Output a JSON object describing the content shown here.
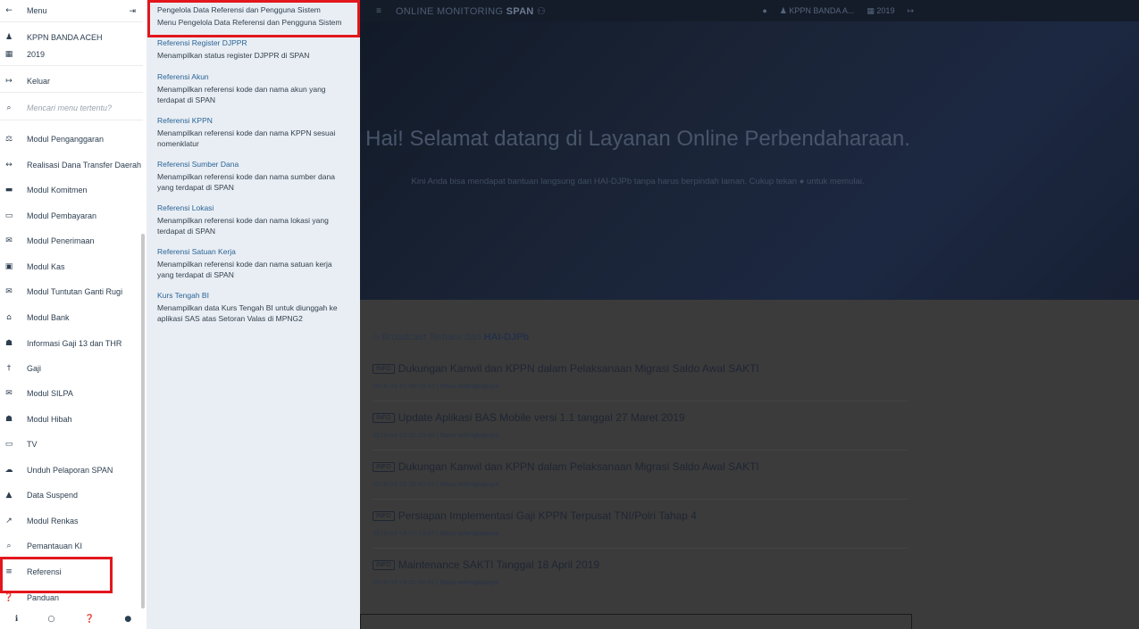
{
  "sidebar": {
    "menu_label": "Menu",
    "user": "KPPN BANDA ACEH",
    "year": "2019",
    "logout": "Keluar",
    "search_placeholder": "Mencari menu tertentu?",
    "items": [
      {
        "label": "Modul Penganggaran",
        "icon": "balance-scale-icon"
      },
      {
        "label": "Realisasi Dana Transfer Daerah",
        "icon": "arrows-h-icon"
      },
      {
        "label": "Modul Komitmen",
        "icon": "archive-icon"
      },
      {
        "label": "Modul Pembayaran",
        "icon": "credit-card-icon"
      },
      {
        "label": "Modul Penerimaan",
        "icon": "envelope-icon"
      },
      {
        "label": "Modul Kas",
        "icon": "money-icon"
      },
      {
        "label": "Modul Tuntutan Ganti Rugi",
        "icon": "envelope-icon"
      },
      {
        "label": "Modul Bank",
        "icon": "bank-icon"
      },
      {
        "label": "Informasi Gaji 13 dan THR",
        "icon": "gift-icon"
      },
      {
        "label": "Gaji",
        "icon": "male-icon"
      },
      {
        "label": "Modul SILPA",
        "icon": "envelope-icon"
      },
      {
        "label": "Modul Hibah",
        "icon": "gift-icon"
      },
      {
        "label": "TV",
        "icon": "desktop-icon"
      },
      {
        "label": "Unduh Pelaporan SPAN",
        "icon": "cloud-download-icon"
      },
      {
        "label": "Data Suspend",
        "icon": "warning-icon"
      },
      {
        "label": "Modul Renkas",
        "icon": "line-chart-icon"
      },
      {
        "label": "Pemantauan KI",
        "icon": "search-icon"
      },
      {
        "label": "Referensi",
        "icon": "signpost-icon"
      },
      {
        "label": "Panduan",
        "icon": "question-circle-icon"
      }
    ]
  },
  "submenu": {
    "items": [
      {
        "title": "Pengelola Data Referensi dan Pengguna Sistem",
        "desc": "Menu Pengelola Data Referensi dan Pengguna Sistem"
      },
      {
        "title": "Referensi Register DJPPR",
        "desc": "Menampilkan status register DJPPR di SPAN"
      },
      {
        "title": "Referensi Akun",
        "desc": "Menampilkan referensi kode dan nama akun yang terdapat di SPAN"
      },
      {
        "title": "Referensi KPPN",
        "desc": "Menampilkan referensi kode dan nama KPPN sesuai nomenklatur"
      },
      {
        "title": "Referensi Sumber Dana",
        "desc": "Menampilkan referensi kode dan nama sumber dana yang terdapat di SPAN"
      },
      {
        "title": "Referensi Lokasi",
        "desc": "Menampilkan referensi kode dan nama lokasi yang terdapat di SPAN"
      },
      {
        "title": "Referensi Satuan Kerja",
        "desc": "Menampilkan referensi kode dan nama satuan kerja yang terdapat di SPAN"
      },
      {
        "title": "Kurs Tengah BI",
        "desc": "Menampilkan data Kurs Tengah BI untuk diunggah ke aplikasi SAS atas Setoran Valas di MPNG2"
      }
    ]
  },
  "topbar": {
    "brand_prefix": "ONLINE MONITORING ",
    "brand_bold": "SPAN",
    "user": "KPPN BANDA A...",
    "year": "2019"
  },
  "hero": {
    "title": "Hai! Selamat datang di Layanan Online Perbendaharaan.",
    "subtitle_a": "Kini Anda bisa mendapat bantuan langsung dari HAI-DJPb tanpa harus berpindah laman. Cukup tekan",
    "subtitle_b": "untuk memulai."
  },
  "broadcast": {
    "heading_prefix": "Broadcast Terbaru dari ",
    "heading_bold": "HAI-DJPb",
    "read_more": "Baca selengkapnya",
    "badge": "INFO",
    "news": [
      {
        "title": "Dukungan Kanwil dan KPPN dalam Pelaksanaan Migrasi Saldo Awal SAKTI",
        "date": "2019-04-25 06:09:40"
      },
      {
        "title": "Update Aplikasi BAS Mobile versi 1.1 tanggal 27 Maret 2019",
        "date": "2019-04-25 02:39:38"
      },
      {
        "title": "Dukungan Kanwil dan KPPN dalam Pelaksanaan Migrasi Saldo Awal SAKTI",
        "date": "2019-04-22 06:40:52"
      },
      {
        "title": "Persiapan Implementasi Gaji KPPN Terpusat TNI/Polri Tahap 4",
        "date": "2019-04-18 07:13:36"
      },
      {
        "title": "Maintenance SAKTI Tanggal 18 April 2019",
        "date": "2019-04-18 01:06:36"
      }
    ]
  },
  "colors": {
    "highlight": "#e3161d",
    "link": "#2a6496"
  }
}
